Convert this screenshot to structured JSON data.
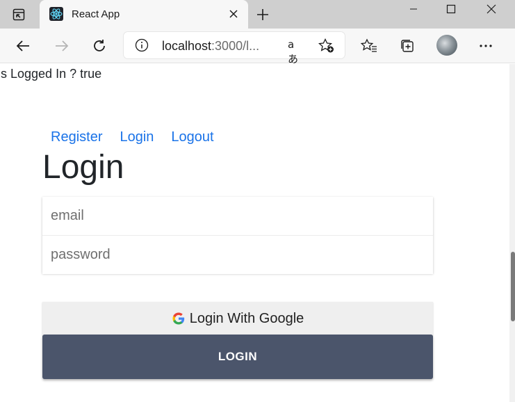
{
  "browser": {
    "tab_title": "React App",
    "url_host": "localhost",
    "url_rest": ":3000/l...",
    "read_aloud_glyph": "aあ",
    "icons": {
      "tab_actions": "tab-actions-icon",
      "favicon": "react-logo-icon",
      "close": "close-icon",
      "new_tab": "plus-icon",
      "minimize": "minimize-icon",
      "maximize": "maximize-icon",
      "window_close": "close-icon",
      "back": "back-arrow-icon",
      "forward": "forward-arrow-icon",
      "refresh": "refresh-icon",
      "site_info": "info-icon",
      "add_favorite": "star-plus-icon",
      "favorites": "favorites-icon",
      "collections": "collections-icon",
      "more": "more-icon"
    }
  },
  "page": {
    "status_text": "Is Logged In ? true",
    "nav": {
      "register": "Register",
      "login": "Login",
      "logout": "Logout"
    },
    "heading": "Login",
    "email_placeholder": "email",
    "password_placeholder": "password",
    "google_button_label": "Login With Google",
    "login_button_label": "LOGIN"
  },
  "colors": {
    "link": "#1a73e8",
    "login_button": "#4b556b",
    "google_button": "#efefef"
  }
}
